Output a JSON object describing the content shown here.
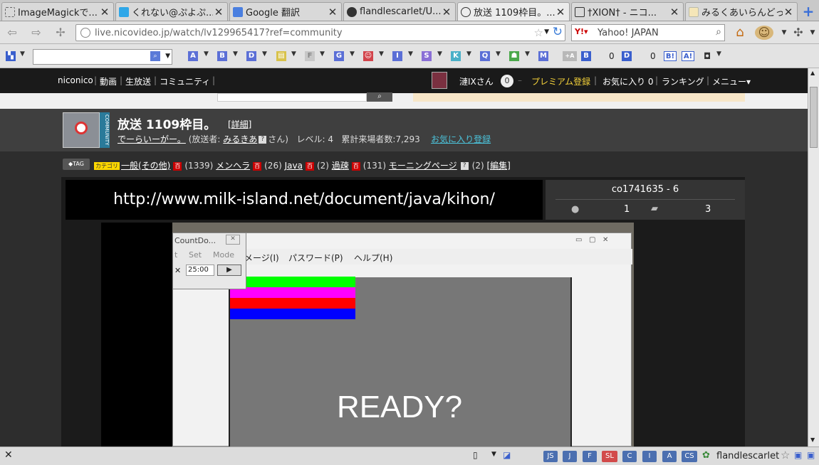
{
  "tabs": [
    {
      "title": "ImageMagickで..."
    },
    {
      "title": "くれない@ぷよぷ..."
    },
    {
      "title": "Google 翻訳"
    },
    {
      "title": "flandlescarlet/U..."
    },
    {
      "title": "放送 1109枠目。..."
    },
    {
      "title": "†XION† - ニコ..."
    },
    {
      "title": "みるくあいらんどっ!"
    }
  ],
  "nav": {
    "url": "live.nicovideo.jp/watch/lv129965417?ref=community",
    "search_engine": "Yahoo! JAPAN"
  },
  "toolbar2": {
    "letters": [
      "A",
      "B",
      "D",
      "F",
      "G",
      "I",
      "S",
      "K",
      "Q",
      "M"
    ],
    "hatena_b": "B",
    "hatena_count": "0",
    "delicious_d": "D",
    "delicious_count": "0"
  },
  "sitenav": {
    "links": [
      "niconico",
      "動画",
      "生放送",
      "コミュニティ"
    ],
    "user": "漣IXさん",
    "points": "0",
    "premium": "プレミアム登録",
    "favorites": "お気に入り 0",
    "ranking": "ランキング",
    "menu": "メニュー▾"
  },
  "program": {
    "title": "放送 1109枠目。",
    "detail_link": "[詳細]",
    "community_name": "でーらいーがー。",
    "broadcaster_label": "(放送者:",
    "broadcaster": "みるきあ",
    "broadcaster_suffix": "さん)",
    "level_label": "レベル:",
    "level": "4",
    "visitors_label": "累計来場者数:",
    "visitors": "7,293",
    "fav_register": "お気に入り登録"
  },
  "tags": {
    "category_badge": "カテゴリ",
    "items": [
      {
        "name": "一般(その他)",
        "count": "(1339)"
      },
      {
        "name": "メンヘラ",
        "count": "(26)"
      },
      {
        "name": "Java",
        "count": "(2)"
      },
      {
        "name": "過疎",
        "count": "(131)"
      },
      {
        "name": "モーニングページ",
        "count": "(2)"
      }
    ],
    "edit": "[編集]"
  },
  "player": {
    "telop": "http://www.milk-island.net/document/java/kihon/",
    "community_id": "co1741635 - 6",
    "viewers": "1",
    "comments": "3",
    "ready_text": "READY?",
    "countdown_title": "CountDo...",
    "countdown_menu": [
      "t",
      "Set",
      "Mode"
    ],
    "countdown_time": "25:00",
    "app_menu": [
      "メージ(I)",
      "パスワード(P)",
      "ヘルプ(H)"
    ]
  },
  "statusbar": {
    "buttons": [
      "JS",
      "J",
      "F",
      "SL",
      "C",
      "I",
      "A",
      "CS"
    ],
    "github_user": "flandlescarlet"
  }
}
